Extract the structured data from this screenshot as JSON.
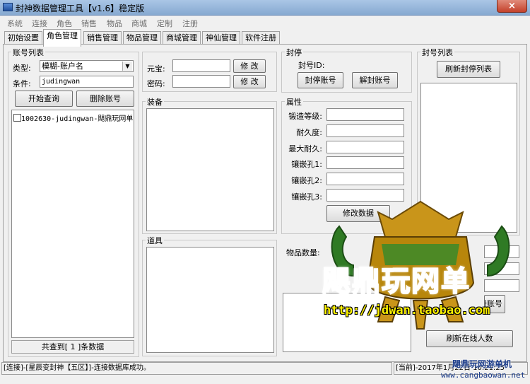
{
  "window": {
    "title": "封神数据管理工具【v1.6】稳定版",
    "close_glyph": "×"
  },
  "menu": [
    "系统",
    "连接",
    "角色",
    "销售",
    "物品",
    "商城",
    "定制",
    "注册"
  ],
  "tabs": [
    "初始设置",
    "角色管理",
    "销售管理",
    "物品管理",
    "商城管理",
    "神仙管理",
    "软件注册"
  ],
  "active_tab": "角色管理",
  "account_list": {
    "title": "账号列表",
    "type_label": "类型:",
    "type_value": "模糊-账户名",
    "cond_label": "条件:",
    "cond_value": "judingwan",
    "query_button": "开始查询",
    "delete_button": "删除账号",
    "items": [
      "1002630-judingwan-飓鼎玩网单"
    ],
    "summary": "共查到[ 1 ]条数据"
  },
  "credentials": {
    "gold_label": "元宝:",
    "gold_value": "",
    "gold_btn": "修 改",
    "pwd_label": "密码:",
    "pwd_value": "",
    "pwd_btn": "修 改"
  },
  "equipment": {
    "title": "装备"
  },
  "items_box": {
    "title": "道具"
  },
  "ban": {
    "title": "封停",
    "id_label": "封号ID:",
    "ban_button": "封停账号",
    "unban_button": "解封账号"
  },
  "attributes": {
    "title": "属性",
    "fields": [
      {
        "label": "锻造等级:",
        "value": ""
      },
      {
        "label": "耐久度:",
        "value": ""
      },
      {
        "label": "最大耐久:",
        "value": ""
      },
      {
        "label": "镶嵌孔1:",
        "value": ""
      },
      {
        "label": "镶嵌孔2:",
        "value": ""
      },
      {
        "label": "镶嵌孔3:",
        "value": ""
      }
    ],
    "modify_button": "修改数据"
  },
  "item_count_label": "物品数量:",
  "ban_list": {
    "title": "封号列表",
    "refresh_button": "刷新封停列表"
  },
  "register_button": "注册账号",
  "online_button": "刷新在线人数",
  "status": {
    "left": "[连接]-[星辰变封神【五区】]-连接数据库成功。",
    "right": "[当前]-2017年1月22日 10:21:25"
  },
  "watermark": {
    "brand": "飓鼎玩网单",
    "url": "http://jdwan.taobao.com",
    "footer": "飓鼎玩网游单机",
    "footer_url": "www.cangbaowan.net"
  },
  "colors": {
    "title_bar": "#9ebbe0",
    "watermark_gold": "#d4a017",
    "watermark_green": "#3a8a2a"
  }
}
